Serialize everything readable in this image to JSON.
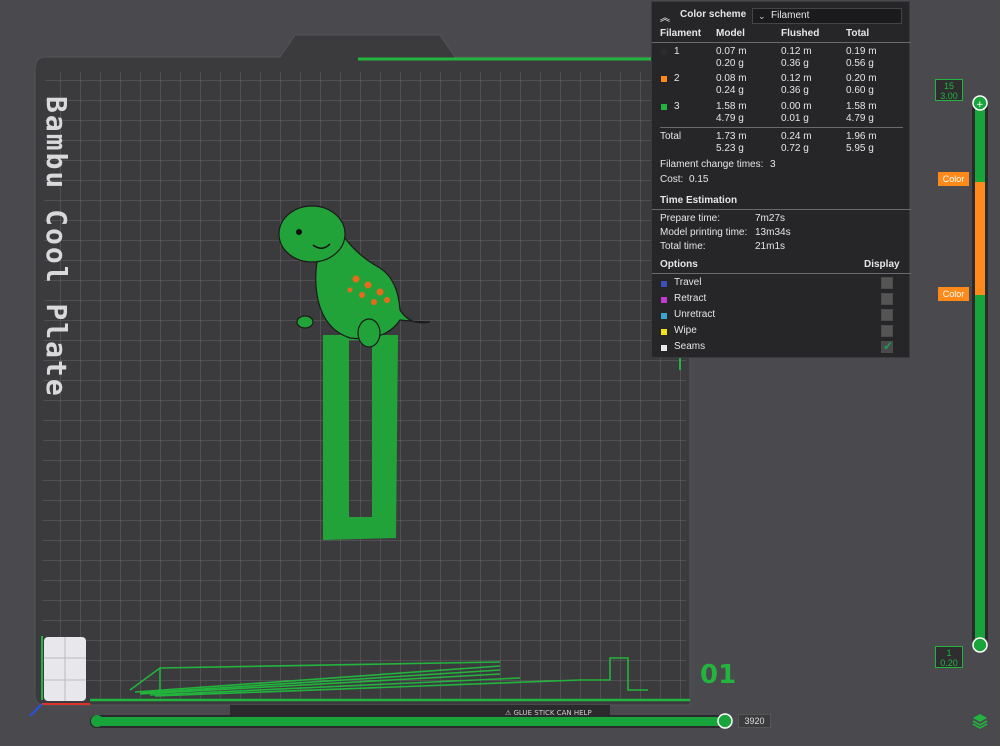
{
  "plate": {
    "title": "Bambu Cool Plate",
    "number": "01"
  },
  "color_scheme": {
    "label": "Color scheme",
    "value": "Filament"
  },
  "filament_table": {
    "headers": [
      "Filament",
      "Model",
      "Flushed",
      "Total"
    ],
    "rows": [
      {
        "id": "1",
        "color": "#2b2b2b",
        "model": [
          "0.07 m",
          "0.20 g"
        ],
        "flushed": [
          "0.12 m",
          "0.36 g"
        ],
        "total": [
          "0.19 m",
          "0.56 g"
        ]
      },
      {
        "id": "2",
        "color": "#ff8a1a",
        "model": [
          "0.08 m",
          "0.24 g"
        ],
        "flushed": [
          "0.12 m",
          "0.36 g"
        ],
        "total": [
          "0.20 m",
          "0.60 g"
        ]
      },
      {
        "id": "3",
        "color": "#22b43c",
        "model": [
          "1.58 m",
          "4.79 g"
        ],
        "flushed": [
          "0.00 m",
          "0.01 g"
        ],
        "total": [
          "1.58 m",
          "4.79 g"
        ]
      }
    ],
    "total": {
      "label": "Total",
      "model": [
        "1.73 m",
        "5.23 g"
      ],
      "flushed": [
        "0.24 m",
        "0.72 g"
      ],
      "total": [
        "1.96 m",
        "5.95 g"
      ]
    }
  },
  "stats": {
    "change_label": "Filament change times:",
    "change_value": "3",
    "cost_label": "Cost:",
    "cost_value": "0.15"
  },
  "time_estimation": {
    "title": "Time Estimation",
    "rows": [
      {
        "label": "Prepare time:",
        "value": "7m27s"
      },
      {
        "label": "Model printing time:",
        "value": "13m34s"
      },
      {
        "label": "Total time:",
        "value": "21m1s"
      }
    ]
  },
  "options": {
    "title": "Options",
    "display_label": "Display",
    "items": [
      {
        "label": "Travel",
        "color": "#3a4fb8",
        "checked": false
      },
      {
        "label": "Retract",
        "color": "#c03ad0",
        "checked": false
      },
      {
        "label": "Unretract",
        "color": "#3aa3d0",
        "checked": false
      },
      {
        "label": "Wipe",
        "color": "#f2e21a",
        "checked": false
      },
      {
        "label": "Seams",
        "color": "#e8e8e8",
        "checked": true
      }
    ]
  },
  "layer_slider": {
    "top_layer": "15",
    "top_height": "3.00",
    "bottom_layer": "1",
    "bottom_height": "0.20",
    "color_tags": [
      "Color",
      "Color"
    ]
  },
  "move_slider": {
    "value": "3920"
  },
  "colors": {
    "accent": "#22b43c",
    "orange": "#ff8a1a",
    "panel_bg": "#262628",
    "plate": "#3b3b3e"
  }
}
